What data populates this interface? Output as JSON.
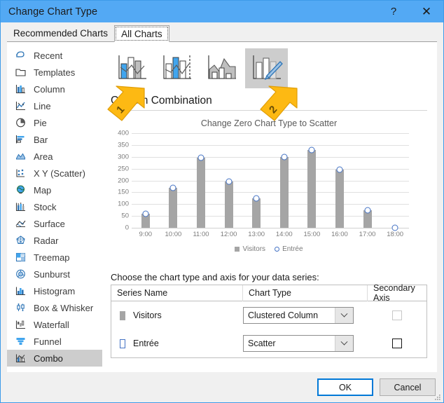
{
  "window": {
    "title": "Change Chart Type",
    "help_label": "?",
    "close_label": "✕"
  },
  "tabs": [
    {
      "label": "Recommended Charts",
      "active": false
    },
    {
      "label": "All Charts",
      "active": true
    }
  ],
  "sidebar": {
    "items": [
      {
        "label": "Recent",
        "icon": "recent-icon",
        "selected": false
      },
      {
        "label": "Templates",
        "icon": "templates-icon",
        "selected": false
      },
      {
        "label": "Column",
        "icon": "column-chart-icon",
        "selected": false
      },
      {
        "label": "Line",
        "icon": "line-chart-icon",
        "selected": false
      },
      {
        "label": "Pie",
        "icon": "pie-chart-icon",
        "selected": false
      },
      {
        "label": "Bar",
        "icon": "bar-chart-icon",
        "selected": false
      },
      {
        "label": "Area",
        "icon": "area-chart-icon",
        "selected": false
      },
      {
        "label": "X Y (Scatter)",
        "icon": "scatter-chart-icon",
        "selected": false
      },
      {
        "label": "Map",
        "icon": "map-chart-icon",
        "selected": false
      },
      {
        "label": "Stock",
        "icon": "stock-chart-icon",
        "selected": false
      },
      {
        "label": "Surface",
        "icon": "surface-chart-icon",
        "selected": false
      },
      {
        "label": "Radar",
        "icon": "radar-chart-icon",
        "selected": false
      },
      {
        "label": "Treemap",
        "icon": "treemap-chart-icon",
        "selected": false
      },
      {
        "label": "Sunburst",
        "icon": "sunburst-chart-icon",
        "selected": false
      },
      {
        "label": "Histogram",
        "icon": "histogram-chart-icon",
        "selected": false
      },
      {
        "label": "Box & Whisker",
        "icon": "box-whisker-chart-icon",
        "selected": false
      },
      {
        "label": "Waterfall",
        "icon": "waterfall-chart-icon",
        "selected": false
      },
      {
        "label": "Funnel",
        "icon": "funnel-chart-icon",
        "selected": false
      },
      {
        "label": "Combo",
        "icon": "combo-chart-icon",
        "selected": true
      }
    ]
  },
  "thumbnails": [
    {
      "name": "clustered-column-line",
      "selected": false
    },
    {
      "name": "clustered-column-line-on-secondary-axis",
      "selected": false
    },
    {
      "name": "stacked-area-clustered-column",
      "selected": false
    },
    {
      "name": "custom-combination",
      "selected": true
    }
  ],
  "combo": {
    "heading": "Custom Combination"
  },
  "chart_data": {
    "type": "bar",
    "title": "Change Zero Chart Type to Scatter",
    "categories": [
      "9:00",
      "10:00",
      "11:00",
      "12:00",
      "13:00",
      "14:00",
      "15:00",
      "16:00",
      "17:00",
      "18:00"
    ],
    "series": [
      {
        "name": "Visitors",
        "type": "column",
        "color": "#a5a5a5",
        "values": [
          60,
          170,
          295,
          195,
          125,
          300,
          330,
          245,
          75,
          0
        ]
      },
      {
        "name": "Entrée",
        "type": "scatter",
        "color": "#4472c4",
        "values": [
          60,
          170,
          295,
          195,
          125,
          300,
          330,
          245,
          75,
          0
        ]
      }
    ],
    "yticks": [
      0,
      50,
      100,
      150,
      200,
      250,
      300,
      350,
      400
    ],
    "ylim": [
      0,
      400
    ],
    "xlabel": "",
    "ylabel": "",
    "grid": true,
    "legend": [
      "Visitors",
      "Entrée"
    ],
    "legend_position": "bottom"
  },
  "series_panel": {
    "instruction": "Choose the chart type and axis for your data series:",
    "columns": [
      "Series Name",
      "Chart Type",
      "Secondary Axis"
    ],
    "rows": [
      {
        "series_name": "Visitors",
        "marker": "square-marker",
        "chart_type": "Clustered Column",
        "secondary_axis_checked": false,
        "secondary_axis_style": "light"
      },
      {
        "series_name": "Entrée",
        "marker": "circle-marker",
        "chart_type": "Scatter",
        "secondary_axis_checked": false,
        "secondary_axis_style": "dark"
      }
    ]
  },
  "callouts": [
    {
      "label": "1",
      "target": "chart-type-dropdown-entree"
    },
    {
      "label": "2",
      "target": "secondary-axis-checkbox-entree"
    }
  ],
  "footer": {
    "ok_label": "OK",
    "cancel_label": "Cancel"
  },
  "colors": {
    "titlebar": "#53a9f4",
    "accent": "#0078d7",
    "bar": "#a5a5a5",
    "marker": "#4472c4",
    "callout": "#fdb913"
  }
}
